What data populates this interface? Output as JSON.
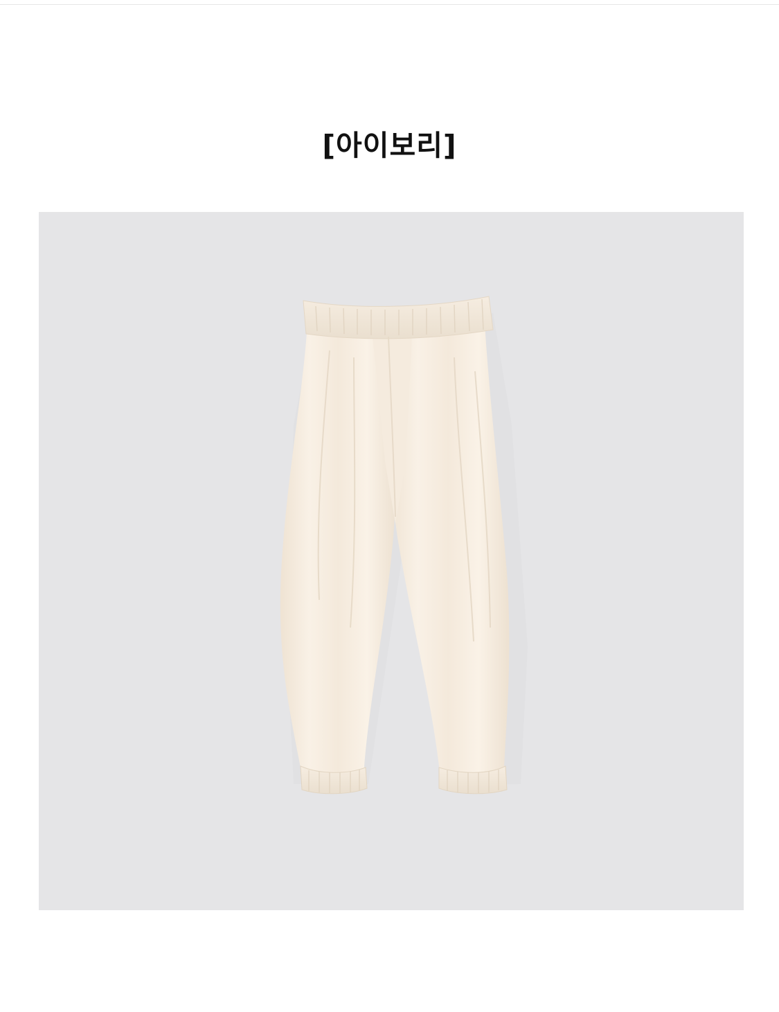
{
  "product": {
    "color_label": "[아이보리]"
  },
  "image": {
    "subject": "pants-icon",
    "background_color": "#e5e5e7",
    "garment_color": "#f7ede0"
  }
}
